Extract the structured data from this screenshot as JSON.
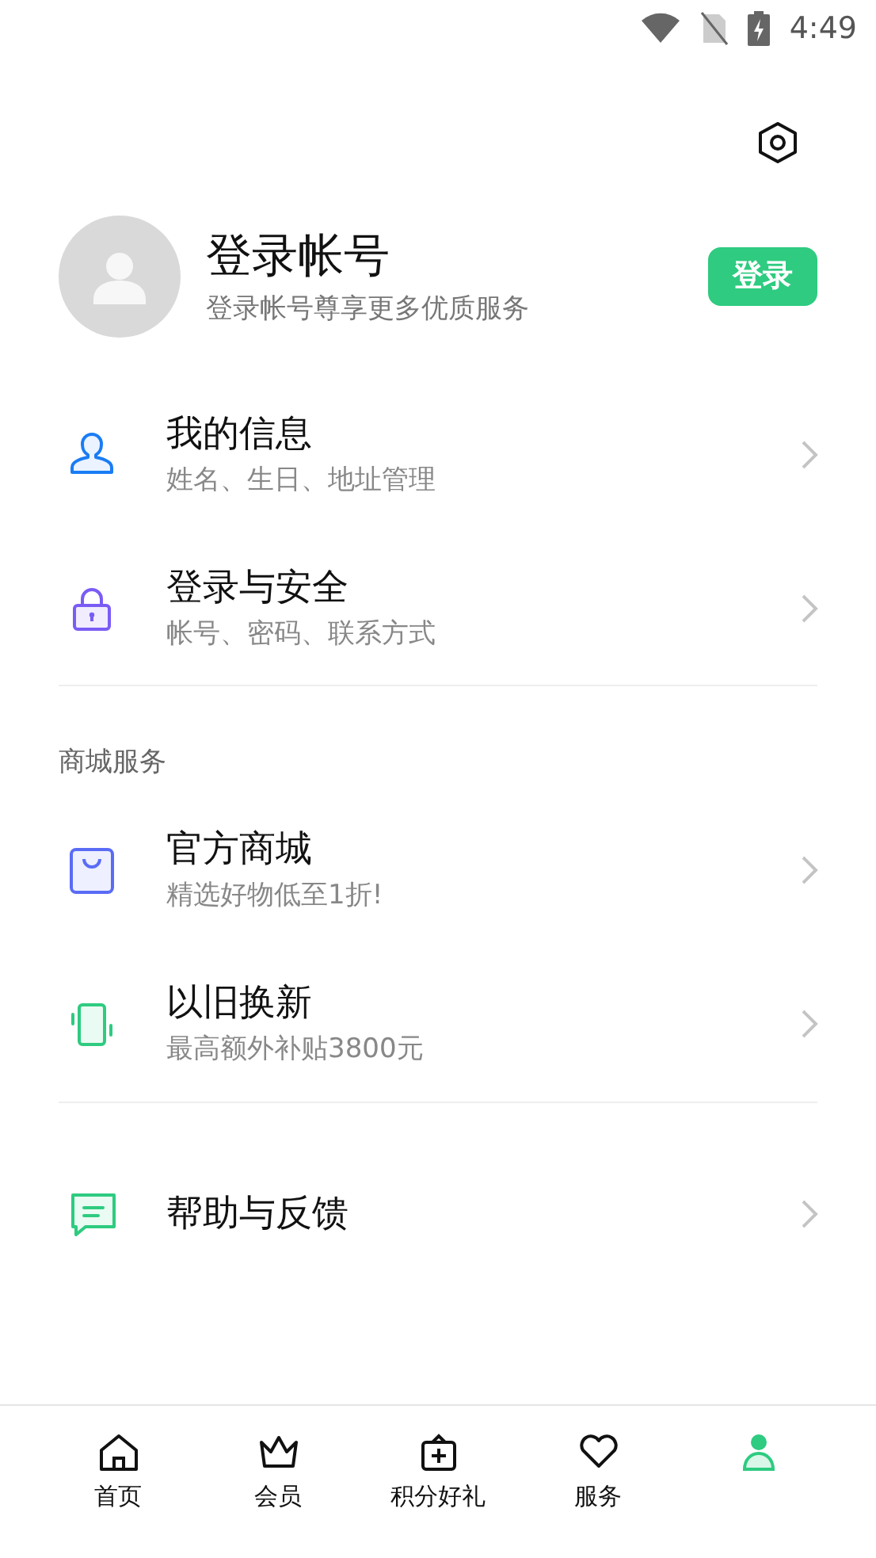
{
  "status_bar": {
    "time": "4:49"
  },
  "profile": {
    "name": "登录帐号",
    "subtitle": "登录帐号尊享更多优质服务",
    "login_button": "登录"
  },
  "account_items": [
    {
      "kind": "user",
      "title": "我的信息",
      "subtitle": "姓名、生日、地址管理"
    },
    {
      "kind": "lock",
      "title": "登录与安全",
      "subtitle": "帐号、密码、联系方式"
    }
  ],
  "shop_section": {
    "title": "商城服务",
    "items": [
      {
        "kind": "bag",
        "title": "官方商城",
        "subtitle": "精选好物低至1折!"
      },
      {
        "kind": "trade",
        "title": "以旧换新",
        "subtitle": "最高额外补贴3800元"
      }
    ]
  },
  "help_item": {
    "kind": "chat",
    "title": "帮助与反馈"
  },
  "tabs": [
    {
      "kind": "home",
      "label": "首页",
      "selected": false
    },
    {
      "kind": "crown",
      "label": "会员",
      "selected": false
    },
    {
      "kind": "gift",
      "label": "积分好礼",
      "selected": false
    },
    {
      "kind": "heart",
      "label": "服务",
      "selected": false
    },
    {
      "kind": "me",
      "selected": true
    }
  ]
}
